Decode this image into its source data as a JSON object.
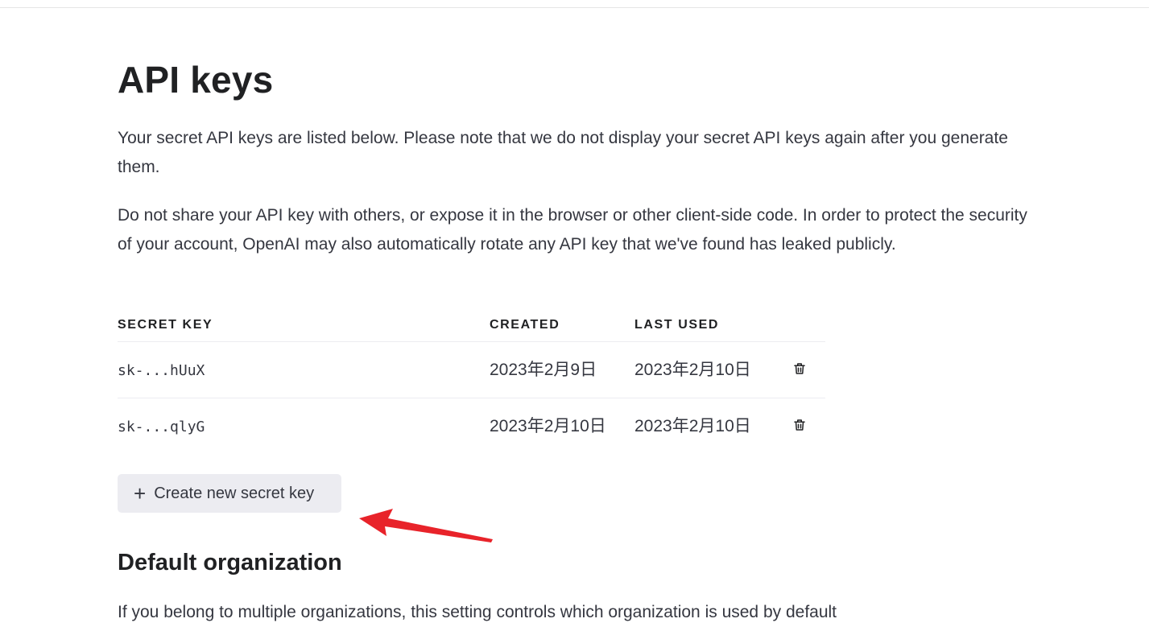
{
  "page": {
    "title": "API keys",
    "description_1": "Your secret API keys are listed below. Please note that we do not display your secret API keys again after you generate them.",
    "description_2": "Do not share your API key with others, or expose it in the browser or other client-side code. In order to protect the security of your account, OpenAI may also automatically rotate any API key that we've found has leaked publicly."
  },
  "table": {
    "headers": {
      "secret_key": "SECRET KEY",
      "created": "CREATED",
      "last_used": "LAST USED"
    },
    "rows": [
      {
        "key": "sk-...hUuX",
        "created": "2023年2月9日",
        "last_used": "2023年2月10日"
      },
      {
        "key": "sk-...qlyG",
        "created": "2023年2月10日",
        "last_used": "2023年2月10日"
      }
    ]
  },
  "actions": {
    "create_label": "Create new secret key",
    "create_icon": "plus-icon",
    "delete_icon": "trash-icon"
  },
  "default_org": {
    "title": "Default organization",
    "description": "If you belong to multiple organizations, this setting controls which organization is used by default"
  },
  "colors": {
    "button_bg": "#ececf1",
    "text": "#353740",
    "heading": "#202123",
    "annotation_arrow": "#e8232a"
  }
}
